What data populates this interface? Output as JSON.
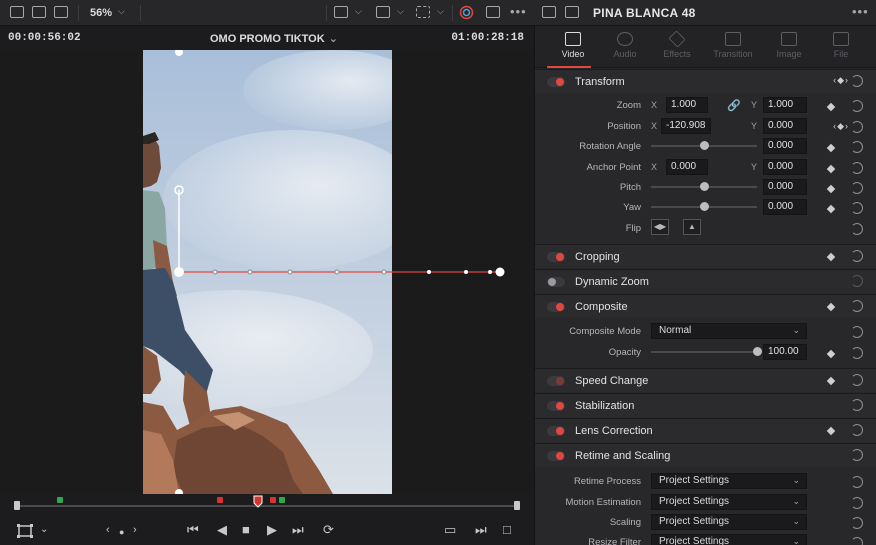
{
  "toolbar": {
    "zoom": "56%",
    "clip_title": "PINA BLANCA 48"
  },
  "viewer": {
    "timecode_left": "00:00:56:02",
    "timeline_name": "OMO PROMO TIKTOK",
    "timecode_right": "01:00:28:18"
  },
  "inspector": {
    "tabs": [
      {
        "label": "Video",
        "icon": "video-icon",
        "active": true
      },
      {
        "label": "Audio",
        "icon": "audio-icon",
        "active": false
      },
      {
        "label": "Effects",
        "icon": "effects-icon",
        "active": false
      },
      {
        "label": "Transition",
        "icon": "transition-icon",
        "active": false
      },
      {
        "label": "Image",
        "icon": "image-icon",
        "active": false
      },
      {
        "label": "File",
        "icon": "file-icon",
        "active": false
      }
    ],
    "transform": {
      "title": "Transform",
      "zoom_label": "Zoom",
      "zoom_x": "1.000",
      "zoom_y": "1.000",
      "position_label": "Position",
      "position_x": "-120.908",
      "position_y": "0.000",
      "rotation_label": "Rotation Angle",
      "rotation": "0.000",
      "anchor_label": "Anchor Point",
      "anchor_x": "0.000",
      "anchor_y": "0.000",
      "pitch_label": "Pitch",
      "pitch": "0.000",
      "yaw_label": "Yaw",
      "yaw": "0.000",
      "flip_label": "Flip",
      "x_axis": "X",
      "y_axis": "Y"
    },
    "cropping": {
      "title": "Cropping"
    },
    "dynamic_zoom": {
      "title": "Dynamic Zoom"
    },
    "composite": {
      "title": "Composite",
      "mode_label": "Composite Mode",
      "mode": "Normal",
      "opacity_label": "Opacity",
      "opacity": "100.00",
      "opacity_level": 1.0
    },
    "speed_change": {
      "title": "Speed Change"
    },
    "stabilization": {
      "title": "Stabilization"
    },
    "lens_correction": {
      "title": "Lens Correction"
    },
    "retime_scaling": {
      "title": "Retime and Scaling",
      "retime_process_label": "Retime Process",
      "retime_process": "Project Settings",
      "motion_estimation_label": "Motion Estimation",
      "motion_estimation": "Project Settings",
      "scaling_label": "Scaling",
      "scaling": "Project Settings",
      "resize_filter_label": "Resize Filter",
      "resize_filter": "Project Settings"
    }
  },
  "colors": {
    "accent_red": "#e0473f",
    "marker_green": "#2faa49",
    "marker_red": "#d8332d"
  }
}
